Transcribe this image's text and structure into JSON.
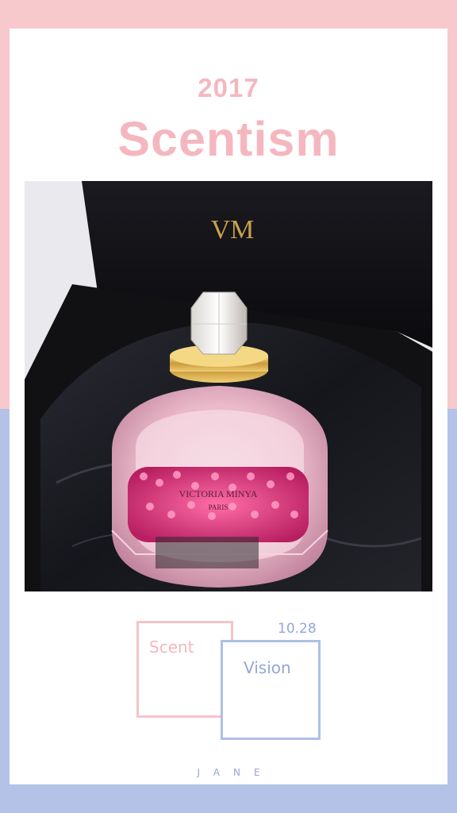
{
  "header": {
    "year": "2017",
    "title": "Scentism"
  },
  "photo": {
    "logo_text": "VM",
    "bottle_label_line1": "VICTORIA MINYA",
    "bottle_label_line2": "PARIS"
  },
  "badge": {
    "scent_label": "Scent",
    "vision_label": "Vision",
    "date": "10.28"
  },
  "footer": {
    "signature": "JANE"
  },
  "colors": {
    "pink": "#f8c9cc",
    "blue": "#b3c2e6",
    "title_pink": "#f5b7bf",
    "box_pink": "#f6c4c8",
    "box_blue": "#aebfe6",
    "text_blue": "#95a6d8"
  }
}
